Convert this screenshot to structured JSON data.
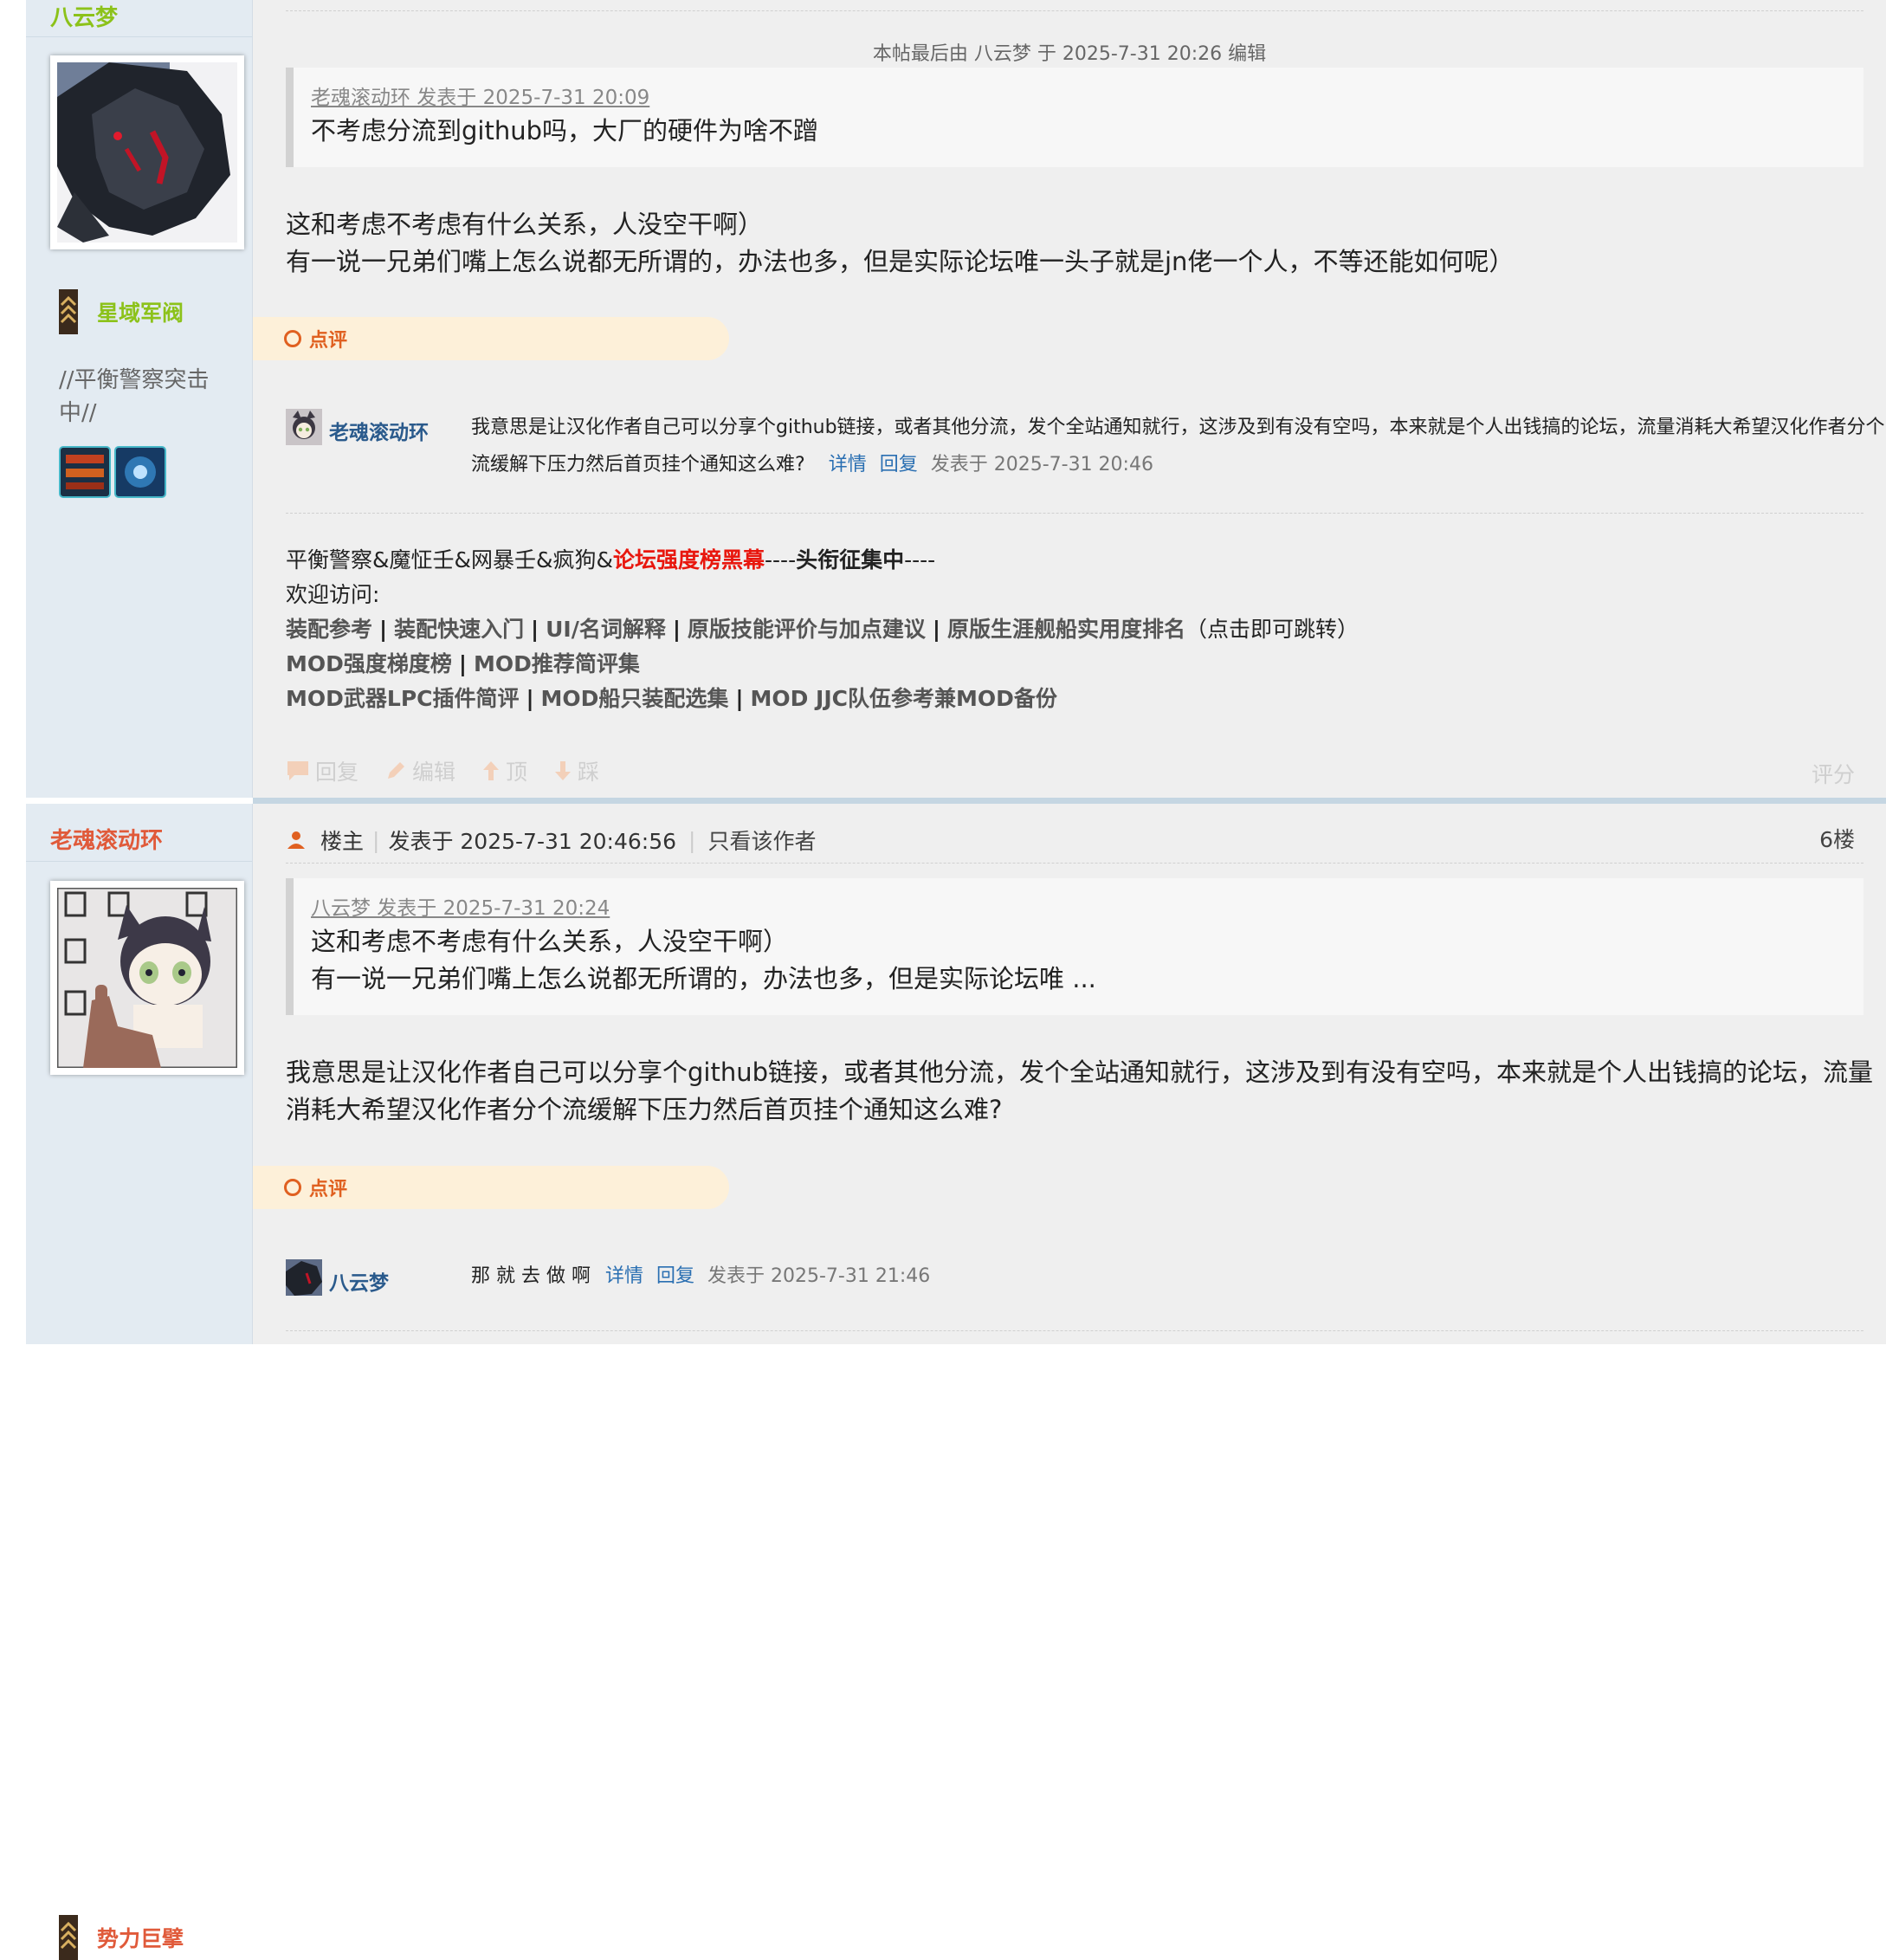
{
  "post1": {
    "username": "八云梦",
    "rank": "星域军阀",
    "signature_side": "//平衡警察突击中//",
    "edit_notice": "本帖最后由 八云梦 于 2025-7-31 20:26 编辑",
    "quote_author": "老魂滚动环 发表于 2025-7-31 20:09",
    "quote_text": "不考虑分流到github吗，大厂的硬件为啥不蹭",
    "body_line1": "这和考虑不考虑有什么关系，人没空干啊）",
    "body_line2": "有一说一兄弟们嘴上怎么说都无所谓的，办法也多，但是实际论坛唯一头子就是jn佬一个人，不等还能如何呢）",
    "dianping_label": "点评",
    "comment": {
      "author": "老魂滚动环",
      "text1": "我意思是让汉化作者自己可以分享个github链接，或者其他分流，发个全站通知就行，这涉及到有没有空吗，本来就是个人出钱搞的论坛，流量消耗大希望汉化作者分个",
      "text2": "流缓解下压力然后首页挂个通知这么难?",
      "detail": "详情",
      "reply": "回复",
      "meta": "发表于 2025-7-31 20:46"
    },
    "sig": {
      "prefix": "平衡警察&魔怔壬&网暴壬&疯狗&",
      "red": "论坛强度榜黑幕",
      "dash1": "----",
      "bold": "头衔征集中",
      "dash2": "----",
      "welcome": "欢迎访问:",
      "links1": [
        "装配参考",
        "装配快速入门",
        "UI/名词解释",
        "原版技能评价与加点建议",
        "原版生涯舰船实用度排名"
      ],
      "links1_note": "（点击即可跳转）",
      "links2": [
        "MOD强度梯度榜",
        "MOD推荐简评集"
      ],
      "links3": [
        "MOD武器LPC插件简评",
        "MOD船只装配选集",
        "MOD JJC队伍参考兼MOD备份"
      ],
      "separator": "|"
    },
    "actions": {
      "reply": "回复",
      "edit": "编辑",
      "up": "顶",
      "down": "踩",
      "rate": "评分"
    }
  },
  "post2": {
    "username": "老魂滚动环",
    "rank": "势力巨擘",
    "op_label": "楼主",
    "posted": "发表于 2025-7-31 20:46:56",
    "only_author": "只看该作者",
    "floor": "6楼",
    "quote_author": "八云梦 发表于 2025-7-31 20:24",
    "quote_line1": "这和考虑不考虑有什么关系，人没空干啊）",
    "quote_line2": "有一说一兄弟们嘴上怎么说都无所谓的，办法也多，但是实际论坛唯 ...",
    "body_line1": "我意思是让汉化作者自己可以分享个github链接，或者其他分流，发个全站通知就行，这涉及到有没有空吗，本来就是个人出钱搞的论坛，流量",
    "body_line2": "消耗大希望汉化作者分个流缓解下压力然后首页挂个通知这么难?",
    "dianping_label": "点评",
    "comment": {
      "author": "八云梦",
      "text": "那 就 去 做 啊",
      "detail": "详情",
      "reply": "回复",
      "meta": "发表于 2025-7-31 21:46"
    }
  },
  "colors": {
    "sidebar_bg": "#e3ebf2",
    "main_bg": "#efefef",
    "user1_name": "#8cc21a",
    "user2_name": "#e05a3a",
    "accent_orange": "#e06020",
    "link_blue": "#2a6fb2",
    "sig_red": "#e8170e"
  }
}
